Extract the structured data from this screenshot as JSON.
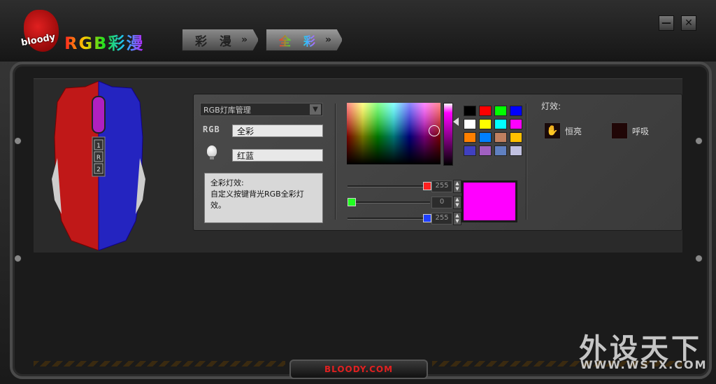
{
  "app": {
    "brand": "bloody",
    "title": "RGB彩漫"
  },
  "tabs": [
    {
      "label": "彩 漫",
      "chevron": "»"
    },
    {
      "label": "全 彩",
      "chevron": "»"
    }
  ],
  "window": {
    "minimize": "—",
    "close": "✕"
  },
  "mouse_buttons": [
    "1",
    "R",
    "2"
  ],
  "left_panel": {
    "library_select": "RGB灯库管理",
    "rgb_label": "RGB",
    "rgb_value": "全彩",
    "bulb_value": "红蓝",
    "description": "全彩灯效:\n自定义按键背光RGB全彩灯效。"
  },
  "color_picker": {
    "swatches": [
      "#000000",
      "#ff0000",
      "#00ff00",
      "#0000ff",
      "#ffffff",
      "#ffff00",
      "#00ffff",
      "#ff00ff",
      "#ff8000",
      "#0080ff",
      "#c08060",
      "#ffc000",
      "#4040c0",
      "#a060c0",
      "#6080c0",
      "#c0c0e0"
    ],
    "sliders": [
      {
        "name": "red",
        "value": "255",
        "color": "#ff2020",
        "level": 1.0
      },
      {
        "name": "green",
        "value": "0",
        "color": "#20ff20",
        "level": 0.0
      },
      {
        "name": "blue",
        "value": "255",
        "color": "#2040ff",
        "level": 1.0
      }
    ],
    "preview_color": "#ff00ff"
  },
  "effects": {
    "title": "灯效:",
    "items": [
      {
        "label": "恒亮",
        "icon": "hand-icon"
      },
      {
        "label": "呼吸",
        "icon": "dark-square-icon"
      }
    ]
  },
  "footer": {
    "site": "BLOODY.COM"
  },
  "watermark": {
    "line1": "外设天下",
    "line2": "WWW.WSTX.COM"
  }
}
